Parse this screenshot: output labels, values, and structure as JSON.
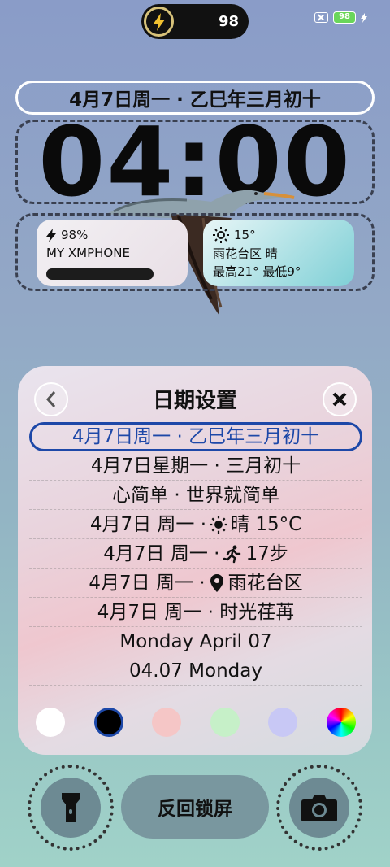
{
  "status_bar": {
    "pill_value": "98",
    "battery": "98",
    "battery_color": "#6ad65a"
  },
  "date_header": "4月7日周一 · 乙巳年三月初十",
  "clock": "04:00",
  "widgets": {
    "phone": {
      "battery": "98%",
      "name": "MY XMPHONE",
      "icon": "bolt-icon"
    },
    "weather": {
      "temp": "15°",
      "location_condition": "雨花台区 晴",
      "range": "最高21° 最低9°",
      "icon": "sun-icon"
    }
  },
  "panel": {
    "title": "日期设置",
    "back_icon": "chevron-left-icon",
    "close_icon": "close-icon",
    "options": [
      {
        "text": "4月7日周一 · 乙巳年三月初十",
        "selected": true
      },
      {
        "text": "4月7日星期一 · 三月初十",
        "selected": false
      },
      {
        "text": "心简单 · 世界就简单",
        "selected": false
      },
      {
        "text_before": "4月7日 周一 · ",
        "icon": "sun-icon",
        "text_after": "晴 15°C",
        "selected": false
      },
      {
        "text_before": "4月7日 周一 · ",
        "icon": "running-icon",
        "text_after": "17步",
        "selected": false
      },
      {
        "text_before": "4月7日 周一 · ",
        "icon": "location-pin-icon",
        "text_after": "雨花台区",
        "selected": false
      },
      {
        "text": "4月7日 周一 · 时光荏苒",
        "selected": false
      },
      {
        "text": "Monday April 07",
        "selected": false
      },
      {
        "text": "04.07 Monday",
        "selected": false
      }
    ],
    "colors": [
      "#ffffff",
      "#000000",
      "#f5c6c6",
      "#c6f0c8",
      "#c8c8f5",
      "rainbow"
    ],
    "selected_color_index": 1
  },
  "bottom": {
    "lock_label": "反回锁屏",
    "left_icon": "flashlight-icon",
    "right_icon": "camera-icon"
  }
}
